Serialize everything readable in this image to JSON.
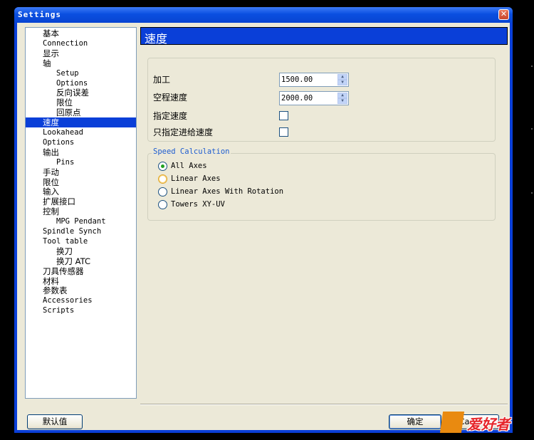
{
  "window": {
    "title": "Settings",
    "close_glyph": "✕"
  },
  "tree": {
    "items": [
      {
        "label": "基本",
        "level": 0,
        "zh": true
      },
      {
        "label": "Connection",
        "level": 0
      },
      {
        "label": "显示",
        "level": 0,
        "zh": true
      },
      {
        "label": "轴",
        "level": 0,
        "zh": true
      },
      {
        "label": "Setup",
        "level": 1
      },
      {
        "label": "Options",
        "level": 1
      },
      {
        "label": "反向误差",
        "level": 1,
        "zh": true
      },
      {
        "label": "限位",
        "level": 1,
        "zh": true
      },
      {
        "label": "回原点",
        "level": 1,
        "zh": true
      },
      {
        "label": "速度",
        "level": 0,
        "zh": true,
        "selected": true
      },
      {
        "label": "Lookahead",
        "level": 0
      },
      {
        "label": "Options",
        "level": 0
      },
      {
        "label": "输出",
        "level": 0,
        "zh": true
      },
      {
        "label": "Pins",
        "level": 1
      },
      {
        "label": "手动",
        "level": 0,
        "zh": true
      },
      {
        "label": "限位",
        "level": 0,
        "zh": true
      },
      {
        "label": "输入",
        "level": 0,
        "zh": true
      },
      {
        "label": "扩展接口",
        "level": 0,
        "zh": true
      },
      {
        "label": "控制",
        "level": 0,
        "zh": true
      },
      {
        "label": "MPG Pendant",
        "level": 1
      },
      {
        "label": "Spindle Synch",
        "level": 0
      },
      {
        "label": "Tool table",
        "level": 0
      },
      {
        "label": "换刀",
        "level": 1,
        "zh": true
      },
      {
        "label": "换刀 ATC",
        "level": 1,
        "zh": true
      },
      {
        "label": "刀具传感器",
        "level": 0,
        "zh": true
      },
      {
        "label": "材料",
        "level": 0,
        "zh": true
      },
      {
        "label": "参数表",
        "level": 0,
        "zh": true
      },
      {
        "label": "Accessories",
        "level": 0
      },
      {
        "label": "Scripts",
        "level": 0
      }
    ]
  },
  "panel": {
    "header": "速度",
    "feed_label": "加工",
    "feed_value": "1500.00",
    "rapid_label": "空程速度",
    "rapid_value": "2000.00",
    "specified_speed_label": "指定速度",
    "specified_speed_checked": false,
    "feed_only_label": "只指定进给速度",
    "feed_only_checked": false
  },
  "speed_calc": {
    "legend": "Speed Calculation",
    "options": [
      {
        "label": "All Axes",
        "selected": true
      },
      {
        "label": "Linear Axes",
        "selected": false
      },
      {
        "label": "Linear Axes With Rotation",
        "selected": false
      },
      {
        "label": "Towers XY-UV",
        "selected": false
      }
    ]
  },
  "buttons": {
    "defaults": "默认值",
    "ok": "确定",
    "cancel": "Cancel"
  },
  "watermark": {
    "text": "爱好者"
  }
}
